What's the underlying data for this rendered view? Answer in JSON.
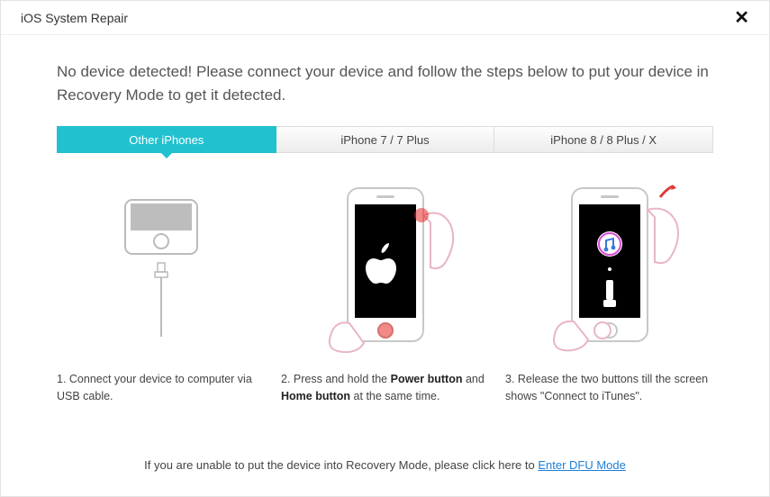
{
  "window": {
    "title": "iOS System Repair"
  },
  "instruction": "No device detected! Please connect your device and follow the steps below to put your device in Recovery Mode to get it detected.",
  "tabs": {
    "t0": "Other iPhones",
    "t1": "iPhone 7 / 7 Plus",
    "t2": "iPhone 8 / 8 Plus / X"
  },
  "steps": {
    "s1_prefix": "1. Connect your device to computer via USB cable.",
    "s2_prefix": "2. Press and hold the ",
    "s2_b1": "Power button",
    "s2_mid": " and ",
    "s2_b2": "Home button",
    "s2_suffix": " at the same time.",
    "s3": "3. Release the two buttons till the screen shows \"Connect to iTunes\"."
  },
  "footer": {
    "text": "If you are unable to put the device into Recovery Mode, please click here to ",
    "link": "Enter DFU Mode"
  }
}
